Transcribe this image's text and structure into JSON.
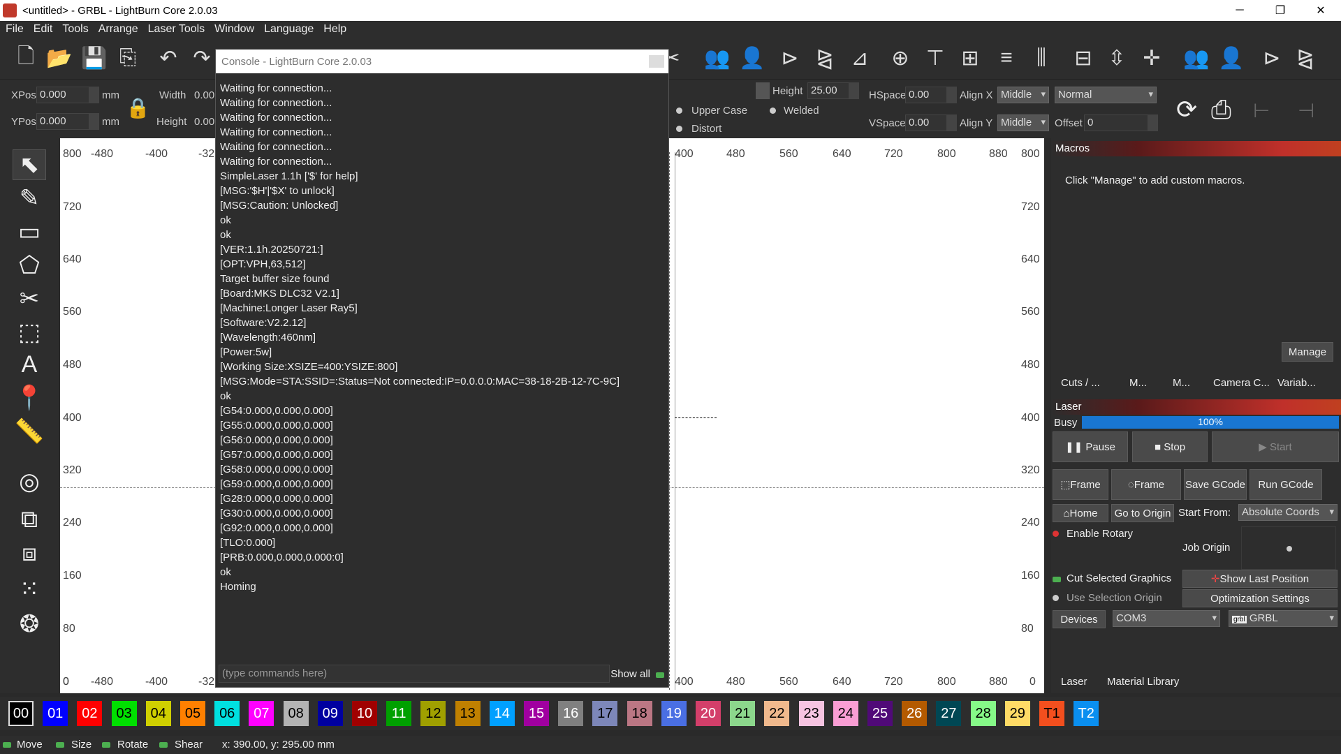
{
  "window": {
    "title": "<untitled> - GRBL - LightBurn Core 2.0.03",
    "minimize": "─",
    "restore": "❐",
    "close": "✕"
  },
  "menu": [
    "File",
    "Edit",
    "Tools",
    "Arrange",
    "Laser Tools",
    "Window",
    "Language",
    "Help"
  ],
  "shape_props": {
    "xpos_label": "XPos",
    "xpos": "0.000",
    "ypos_label": "YPos",
    "ypos": "0.000",
    "unit": "mm",
    "width_label": "Width",
    "width": "0.00",
    "height_label": "Height",
    "height": "0.00"
  },
  "text_props": {
    "height_label": "Height",
    "height": "25.00",
    "hspace_label": "HSpace",
    "hspace": "0.00",
    "vspace_label": "VSpace",
    "vspace": "0.00",
    "alignx_label": "Align X",
    "alignx": "Middle",
    "aligny_label": "Align Y",
    "aligny": "Middle",
    "mode": "Normal",
    "offset_label": "Offset",
    "offset": "0",
    "upper_case": "Upper Case",
    "welded": "Welded",
    "distort": "Distort"
  },
  "rulers": {
    "top": [
      "800",
      "-480",
      "-400",
      "-32",
      "400",
      "480",
      "560",
      "640",
      "720",
      "800",
      "880",
      "800"
    ],
    "left": [
      "720",
      "640",
      "560",
      "480",
      "400",
      "320",
      "240",
      "160",
      "80",
      "0"
    ],
    "bottom": [
      "0",
      "-480",
      "-400",
      "-32",
      "400",
      "480",
      "560",
      "640",
      "720",
      "800",
      "880",
      "0"
    ],
    "right": [
      "720",
      "640",
      "560",
      "480",
      "400",
      "320",
      "240",
      "160",
      "80"
    ]
  },
  "console": {
    "title": "Console - LightBurn Core 2.0.03",
    "lines": [
      "Waiting for connection...",
      "Waiting for connection...",
      "Waiting for connection...",
      "Waiting for connection...",
      "Waiting for connection...",
      "Waiting for connection...",
      "SimpleLaser 1.1h ['$' for help]",
      "[MSG:'$H'|'$X' to unlock]",
      "[MSG:Caution: Unlocked]",
      "ok",
      "ok",
      "[VER:1.1h.20250721:]",
      "[OPT:VPH,63,512]",
      "Target buffer size found",
      "[Board:MKS DLC32 V2.1]",
      "[Machine:Longer Laser Ray5]",
      "[Software:V2.2.12]",
      "[Wavelength:460nm]",
      "[Power:5w]",
      "[Working Size:XSIZE=400:YSIZE:800]",
      "[MSG:Mode=STA:SSID=:Status=Not connected:IP=0.0.0.0:MAC=38-18-2B-12-7C-9C]",
      "ok",
      "[G54:0.000,0.000,0.000]",
      "[G55:0.000,0.000,0.000]",
      "[G56:0.000,0.000,0.000]",
      "[G57:0.000,0.000,0.000]",
      "[G58:0.000,0.000,0.000]",
      "[G59:0.000,0.000,0.000]",
      "[G28:0.000,0.000,0.000]",
      "[G30:0.000,0.000,0.000]",
      "[G92:0.000,0.000,0.000]",
      "[TLO:0.000]",
      "[PRB:0.000,0.000,0.000:0]",
      "ok",
      "Homing"
    ],
    "placeholder": "(type commands here)",
    "show_all": "Show all"
  },
  "macros": {
    "title": "Macros",
    "hint": "Click \"Manage\" to add custom macros.",
    "manage": "Manage"
  },
  "tabs": [
    "Cuts / ...",
    "M...",
    "M...",
    "Camera C...",
    "Variab..."
  ],
  "laser": {
    "title": "Laser",
    "busy": "Busy",
    "progress": "100%",
    "progress_value": 100,
    "pause": "Pause",
    "stop": "Stop",
    "start": "Start",
    "frame1": "Frame",
    "frame2": "Frame",
    "save_gcode": "Save GCode",
    "run_gcode": "Run GCode",
    "home": "Home",
    "go_origin": "Go to Origin",
    "start_from_label": "Start From:",
    "start_from": "Absolute Coords",
    "enable_rotary": "Enable Rotary",
    "job_origin": "Job Origin",
    "cut_selected": "Cut Selected Graphics",
    "show_last": "Show Last Position",
    "use_selection": "Use Selection Origin",
    "optimization": "Optimization Settings",
    "devices": "Devices",
    "port": "COM3",
    "device": "GRBL"
  },
  "bottom_tabs": [
    "Laser",
    "Material Library"
  ],
  "palette": [
    {
      "l": "00",
      "c": "#000000",
      "t": "#ffffff"
    },
    {
      "l": "01",
      "c": "#0000ff",
      "t": "#ffffff"
    },
    {
      "l": "02",
      "c": "#ff0000",
      "t": "#ffffff"
    },
    {
      "l": "03",
      "c": "#00e000",
      "t": "#000000"
    },
    {
      "l": "04",
      "c": "#d0d000",
      "t": "#000000"
    },
    {
      "l": "05",
      "c": "#ff8000",
      "t": "#000000"
    },
    {
      "l": "06",
      "c": "#00e0e0",
      "t": "#000000"
    },
    {
      "l": "07",
      "c": "#ff00ff",
      "t": "#ffffff"
    },
    {
      "l": "08",
      "c": "#b4b4b4",
      "t": "#000000"
    },
    {
      "l": "09",
      "c": "#0000a0",
      "t": "#ffffff"
    },
    {
      "l": "10",
      "c": "#a00000",
      "t": "#ffffff"
    },
    {
      "l": "11",
      "c": "#00a000",
      "t": "#ffffff"
    },
    {
      "l": "12",
      "c": "#a0a000",
      "t": "#000000"
    },
    {
      "l": "13",
      "c": "#c08000",
      "t": "#000000"
    },
    {
      "l": "14",
      "c": "#00a0ff",
      "t": "#ffffff"
    },
    {
      "l": "15",
      "c": "#a000a0",
      "t": "#ffffff"
    },
    {
      "l": "16",
      "c": "#808080",
      "t": "#ffffff"
    },
    {
      "l": "17",
      "c": "#7d87b9",
      "t": "#000000"
    },
    {
      "l": "18",
      "c": "#bb7784",
      "t": "#000000"
    },
    {
      "l": "19",
      "c": "#4a6fe3",
      "t": "#ffffff"
    },
    {
      "l": "20",
      "c": "#d33f6a",
      "t": "#ffffff"
    },
    {
      "l": "21",
      "c": "#8cd78c",
      "t": "#000000"
    },
    {
      "l": "22",
      "c": "#f0b98d",
      "t": "#000000"
    },
    {
      "l": "23",
      "c": "#f6c4e1",
      "t": "#000000"
    },
    {
      "l": "24",
      "c": "#fa9ed4",
      "t": "#000000"
    },
    {
      "l": "25",
      "c": "#500a78",
      "t": "#ffffff"
    },
    {
      "l": "26",
      "c": "#b45a00",
      "t": "#ffffff"
    },
    {
      "l": "27",
      "c": "#004754",
      "t": "#ffffff"
    },
    {
      "l": "28",
      "c": "#86fa88",
      "t": "#000000"
    },
    {
      "l": "29",
      "c": "#ffdb66",
      "t": "#000000"
    },
    {
      "l": "T1",
      "c": "#f34f1e",
      "t": "#000000"
    },
    {
      "l": "T2",
      "c": "#0a8ff0",
      "t": "#ffffff"
    }
  ],
  "status": {
    "move": "Move",
    "size": "Size",
    "rotate": "Rotate",
    "shear": "Shear",
    "coords": "x: 390.00, y: 295.00 mm"
  }
}
